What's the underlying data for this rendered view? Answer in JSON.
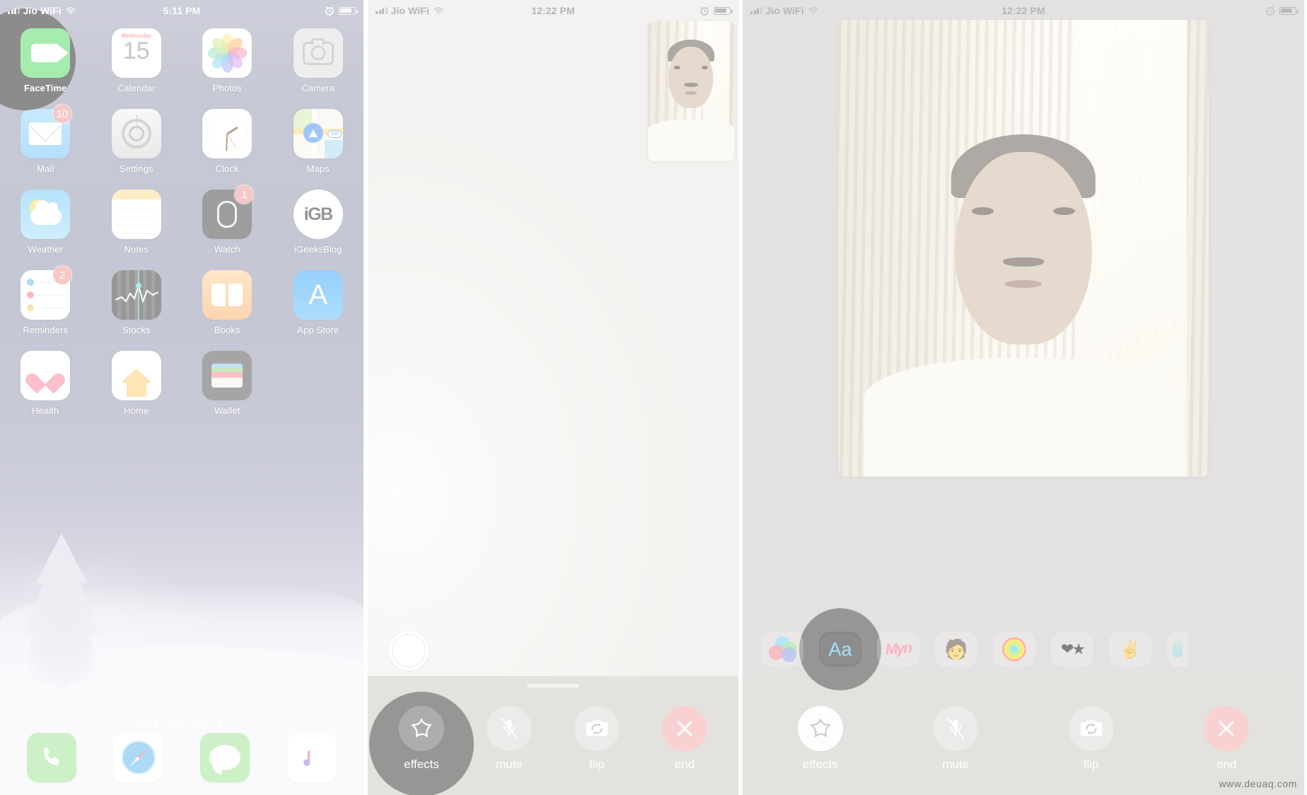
{
  "panels": {
    "home": {
      "status": {
        "carrier": "Jio WiFi",
        "time": "5:11 PM",
        "wifi_icon": "wifi-icon",
        "signal_icon": "cellular-bars-icon",
        "alarm_icon": "alarm-clock-icon",
        "battery_icon": "battery-icon"
      },
      "apps": [
        {
          "label": "FaceTime",
          "icon": "facetime-icon",
          "badge": null,
          "tapped": true
        },
        {
          "label": "Calendar",
          "icon": "calendar-icon",
          "badge": null,
          "calendar_weekday": "Wednesday",
          "calendar_day": "15"
        },
        {
          "label": "Photos",
          "icon": "photos-icon",
          "badge": null
        },
        {
          "label": "Camera",
          "icon": "camera-icon",
          "badge": null
        },
        {
          "label": "Mail",
          "icon": "mail-icon",
          "badge": "10"
        },
        {
          "label": "Settings",
          "icon": "settings-gear-icon",
          "badge": null
        },
        {
          "label": "Clock",
          "icon": "clock-icon",
          "badge": null
        },
        {
          "label": "Maps",
          "icon": "maps-icon",
          "badge": null,
          "maps_label": "280"
        },
        {
          "label": "Weather",
          "icon": "weather-icon",
          "badge": null
        },
        {
          "label": "Notes",
          "icon": "notes-icon",
          "badge": null
        },
        {
          "label": "Watch",
          "icon": "watch-icon",
          "badge": "1"
        },
        {
          "label": "iGeeksBlog",
          "icon": "igeeksblog-icon",
          "badge": null,
          "igb_text": "iGB"
        },
        {
          "label": "Reminders",
          "icon": "reminders-icon",
          "badge": "2"
        },
        {
          "label": "Stocks",
          "icon": "stocks-icon",
          "badge": null
        },
        {
          "label": "Books",
          "icon": "books-icon",
          "badge": null
        },
        {
          "label": "App Store",
          "icon": "app-store-icon",
          "badge": null,
          "appstore_glyph": "A"
        },
        {
          "label": "Health",
          "icon": "health-heart-icon",
          "badge": null
        },
        {
          "label": "Home",
          "icon": "home-house-icon",
          "badge": null
        },
        {
          "label": "Wallet",
          "icon": "wallet-icon",
          "badge": null
        }
      ],
      "dock": [
        {
          "label": "Phone",
          "icon": "phone-icon"
        },
        {
          "label": "Safari",
          "icon": "safari-compass-icon"
        },
        {
          "label": "Messages",
          "icon": "messages-bubble-icon"
        },
        {
          "label": "Music",
          "icon": "music-note-icon"
        }
      ],
      "page_dots": {
        "count": 7,
        "active_index": 1
      }
    },
    "call_collapsed": {
      "status": {
        "carrier": "Jio WiFi",
        "time": "12:22 PM",
        "wifi_icon": "wifi-icon",
        "signal_icon": "cellular-bars-icon",
        "alarm_icon": "alarm-clock-icon",
        "battery_icon": "battery-icon"
      },
      "shutter_icon": "camera-shutter-button",
      "pip_label": "self-view-preview",
      "controls": [
        {
          "label": "effects",
          "icon": "effects-star-icon",
          "tapped": true
        },
        {
          "label": "mute",
          "icon": "microphone-muted-icon",
          "tapped": false
        },
        {
          "label": "flip",
          "icon": "camera-flip-icon",
          "tapped": false
        },
        {
          "label": "end",
          "icon": "end-call-x-icon",
          "tapped": false,
          "color": "#f5a3a3"
        }
      ]
    },
    "call_effects": {
      "status": {
        "carrier": "Jio WiFi",
        "time": "12:22 PM",
        "wifi_icon": "wifi-icon",
        "signal_icon": "cellular-bars-icon",
        "alarm_icon": "alarm-clock-icon",
        "battery_icon": "battery-icon"
      },
      "big_view_label": "self-view-large",
      "effects_strip": [
        {
          "name": "filters",
          "icon": "color-filters-icon",
          "tapped": false
        },
        {
          "name": "text",
          "icon": "text-aa-icon",
          "label": "Aa",
          "tapped": true
        },
        {
          "name": "shapes",
          "icon": "scribble-handwriting-icon",
          "label": "Myn",
          "tapped": false
        },
        {
          "name": "memoji",
          "icon": "memoji-icon",
          "label": "🧑",
          "tapped": false
        },
        {
          "name": "activity",
          "icon": "activity-rings-icon",
          "tapped": false
        },
        {
          "name": "stickers",
          "icon": "sticker-pack-icon",
          "label": "❤★",
          "tapped": false
        },
        {
          "name": "emoji",
          "icon": "emoji-hands-icon",
          "label": "✌",
          "tapped": false
        },
        {
          "name": "more",
          "icon": "more-effects-icon",
          "tapped": false
        }
      ],
      "controls": [
        {
          "label": "effects",
          "icon": "effects-star-icon",
          "tapped": true
        },
        {
          "label": "mute",
          "icon": "microphone-muted-icon",
          "tapped": false
        },
        {
          "label": "flip",
          "icon": "camera-flip-icon",
          "tapped": false
        },
        {
          "label": "end",
          "icon": "end-call-x-icon",
          "tapped": false,
          "color": "#f5a3a3"
        }
      ]
    }
  },
  "watermark": "www.deuaq.com",
  "colors": {
    "facetime_green": "#4cd95e",
    "badge_red": "#f08e8e",
    "end_red": "#f5a3a3",
    "accent_blue": "#49c6ff",
    "tray_grey": "#c7c4bf",
    "highlight_dark": "#2e2c29"
  }
}
